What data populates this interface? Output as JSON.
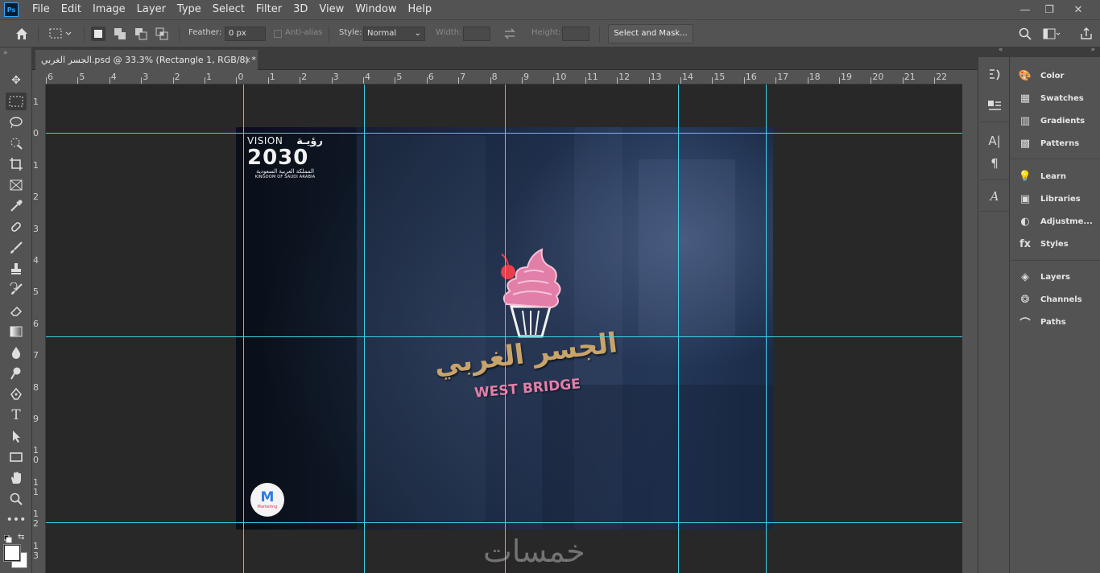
{
  "app": {
    "logo": "Ps"
  },
  "menu": [
    "File",
    "Edit",
    "Image",
    "Layer",
    "Type",
    "Select",
    "Filter",
    "3D",
    "View",
    "Window",
    "Help"
  ],
  "window_controls": {
    "minimize": "—",
    "restore": "❐",
    "close": "✕"
  },
  "options": {
    "feather_label": "Feather:",
    "feather_value": "0 px",
    "antialias_label": "Anti-alias",
    "style_label": "Style:",
    "style_value": "Normal",
    "width_label": "Width:",
    "height_label": "Height:",
    "select_mask_label": "Select and Mask..."
  },
  "document": {
    "tab_title": "الجسر الغربي.psd @ 33.3% (Rectangle 1, RGB/8) *",
    "close": "×"
  },
  "ruler": {
    "top_labels": [
      "6",
      "5",
      "4",
      "3",
      "2",
      "1",
      "0",
      "1",
      "2",
      "3",
      "4",
      "5",
      "6",
      "7",
      "8",
      "9",
      "10",
      "11",
      "12",
      "13",
      "14",
      "15",
      "16",
      "17",
      "18",
      "19",
      "20",
      "21",
      "22"
    ],
    "left_labels": [
      "1",
      "0",
      "1",
      "2",
      "3",
      "4",
      "5",
      "6",
      "7",
      "8",
      "9",
      "1\n0",
      "1\n1",
      "1\n2",
      "1\n3"
    ]
  },
  "artwork": {
    "vision_text": "VISION",
    "vision_arabic": "رؤيـة",
    "vision_year": "2030",
    "kingdom_arabic": "المملكة العربية السعودية",
    "kingdom_english": "KINGDOM OF SAUDI ARABIA",
    "logo_arabic": "الجسر الغربي",
    "logo_english": "WEST BRIDGE",
    "badge_letter": "M",
    "badge_text": "Marketing"
  },
  "watermark": "خمسات",
  "panels": [
    {
      "label": "Color",
      "icon": "color-icon"
    },
    {
      "label": "Swatches",
      "icon": "swatches-icon"
    },
    {
      "label": "Gradients",
      "icon": "gradients-icon"
    },
    {
      "label": "Patterns",
      "icon": "patterns-icon"
    },
    {
      "label": "Learn",
      "icon": "learn-icon"
    },
    {
      "label": "Libraries",
      "icon": "libraries-icon"
    },
    {
      "label": "Adjustme...",
      "icon": "adjustments-icon"
    },
    {
      "label": "Styles",
      "icon": "styles-icon"
    },
    {
      "label": "Layers",
      "icon": "layers-icon"
    },
    {
      "label": "Channels",
      "icon": "channels-icon"
    },
    {
      "label": "Paths",
      "icon": "paths-icon"
    }
  ],
  "colors": {
    "accent_guide": "#3fd1e6",
    "pink": "#e27fa9",
    "gold": "#c9a46a",
    "cherry": "#e83f4f"
  }
}
